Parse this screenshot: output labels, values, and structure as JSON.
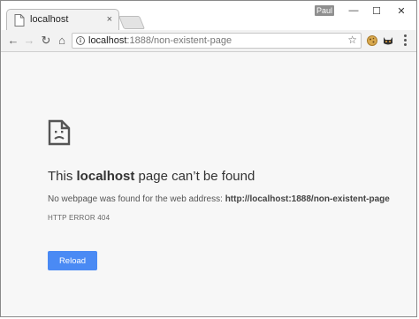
{
  "tab": {
    "title": "localhost",
    "close_glyph": "×"
  },
  "window": {
    "user_badge": "Paul",
    "minimize": "—",
    "maximize": "☐",
    "close": "✕"
  },
  "toolbar": {
    "back_glyph": "←",
    "forward_glyph": "→",
    "reload_glyph": "↻",
    "home_glyph": "⌂",
    "url_host": "localhost",
    "url_path": ":1888/non-existent-page",
    "star_glyph": "☆"
  },
  "error": {
    "heading_prefix": "This ",
    "heading_host": "localhost",
    "heading_suffix": " page can’t be found",
    "desc_prefix": "No webpage was found for the web address: ",
    "desc_url": "http://localhost:1888/non-existent-page",
    "code": "HTTP ERROR 404",
    "reload_label": "Reload"
  },
  "colors": {
    "accent": "#4a8af4",
    "page_bg": "#f7f7f7",
    "chrome_bg": "#f2f2f2"
  },
  "icons": [
    "document-icon",
    "close-icon",
    "back-icon",
    "forward-icon",
    "reload-icon",
    "home-icon",
    "info-icon",
    "star-icon",
    "cookie-extension-icon",
    "cat-extension-icon",
    "menu-icon",
    "sad-document-icon"
  ]
}
